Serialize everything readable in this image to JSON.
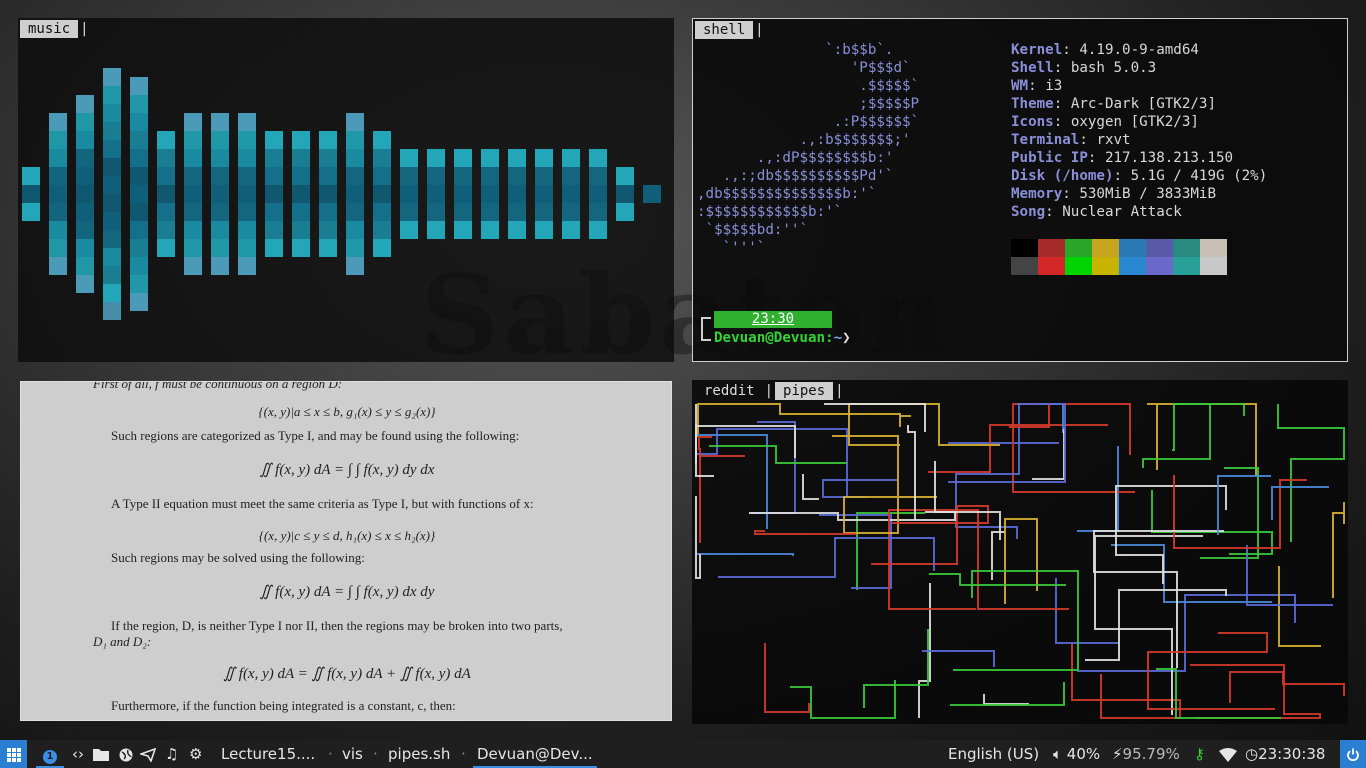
{
  "colors": {
    "accent": "#2a7fd0",
    "viz_teal": "#1a9bb0",
    "prompt_green": "#33d433",
    "logo_purple": "#8a8fd8"
  },
  "wallpaper": {
    "text": "Sabaton"
  },
  "music_window": {
    "tab": "music",
    "visualizer_levels": [
      3,
      9,
      11,
      14,
      13,
      7,
      9,
      9,
      9,
      7,
      7,
      7,
      9,
      7,
      5,
      5,
      5,
      5,
      5,
      5,
      5,
      5,
      3,
      1
    ]
  },
  "shell_window": {
    "tab": "shell",
    "logo_lines": [
      "               `:b$$b`.",
      "                  'P$$$d`",
      "                   .$$$$$`",
      "                   ;$$$$$P",
      "                .:P$$$$$$`",
      "            .,:b$$$$$$$;'",
      "       .,:dP$$$$$$$$b:'",
      "   .,:;db$$$$$$$$$$Pd'`",
      ",db$$$$$$$$$$$$$$b:'`",
      ":$$$$$$$$$$$$b:'`",
      " `$$$$$bd:''`",
      "   `'''`"
    ],
    "info": [
      {
        "key": "Kernel",
        "value": "4.19.0-9-amd64"
      },
      {
        "key": "Shell",
        "value": "bash 5.0.3"
      },
      {
        "key": "WM",
        "value": "i3"
      },
      {
        "key": "Theme",
        "value": "Arc-Dark [GTK2/3]"
      },
      {
        "key": "Icons",
        "value": "oxygen [GTK2/3]"
      },
      {
        "key": "Terminal",
        "value": "rxvt"
      },
      {
        "key": "Public IP",
        "value": "217.138.213.150"
      },
      {
        "key": "Disk (/home)",
        "value": "5.1G / 419G (2%)"
      },
      {
        "key": "Memory",
        "value": "530MiB / 3833MiB"
      },
      {
        "key": "Song",
        "value": "Nuclear Attack"
      }
    ],
    "palette_dark": [
      "#000000",
      "#a52a2a",
      "#2aa52a",
      "#c8a51e",
      "#2a78b4",
      "#5a58a8",
      "#2a8a82",
      "#c8c0b4"
    ],
    "palette_bright": [
      "#444444",
      "#d42828",
      "#00d400",
      "#c8b400",
      "#2a88d0",
      "#6a68c8",
      "#28a098",
      "#c8c8c8"
    ],
    "clock": "23:30",
    "prompt_user": "Devuan@Devuan",
    "prompt_sep": ":",
    "prompt_path": "~",
    "prompt_end": "❯"
  },
  "document": {
    "top_partial": "First of all, f must be continuous on a region D:",
    "eq1": "{(x, y)|a ≤ x ≤ b, g₁(x) ≤ y ≤ g₂(x)}",
    "p1": "Such regions are categorized as Type I, and may be found using the following:",
    "eq2": "∬ f(x, y) dA = ∫ ∫ f(x, y) dy dx",
    "p2": "A Type II equation must meet the same criteria as Type I, but with functions of x:",
    "eq3": "{(x, y)|c ≤ y ≤ d, h₁(x) ≤ x ≤ h₂(x)}",
    "p3": "Such regions may be solved using the following:",
    "eq4": "∬ f(x, y) dA = ∫ ∫ f(x, y) dx dy",
    "p4a": "If the region, D, is neither Type I nor II, then the regions may be broken into two parts,",
    "p4b": "D₁ and D₂:",
    "eq5": "∬ f(x, y) dA = ∬ f(x, y) dA + ∬ f(x, y) dA",
    "p5": "Furthermore, if the function being integrated is a constant, c, then:"
  },
  "pipes_window": {
    "tabs": [
      {
        "label": "reddit",
        "active": false
      },
      {
        "label": "pipes",
        "active": true
      }
    ],
    "pipe_colors": [
      "#e0e0e0",
      "#d43a2a",
      "#5a6ad8",
      "#d8b030",
      "#3ac83a",
      "#4a8ad8"
    ]
  },
  "taskbar": {
    "workspace": "1",
    "launcher_icons": [
      "code-icon",
      "folder-icon",
      "globe-icon",
      "send-icon",
      "music-icon",
      "gear-icon"
    ],
    "tasks": [
      {
        "label": "Lecture15....",
        "active": false
      },
      {
        "label": "vis",
        "active": false
      },
      {
        "label": "pipes.sh",
        "active": false
      },
      {
        "label": "Devuan@Dev...",
        "active": true
      }
    ],
    "keyboard_layout": "English (US)",
    "volume": "40%",
    "battery": "95.79%",
    "time": "23:30:38"
  }
}
